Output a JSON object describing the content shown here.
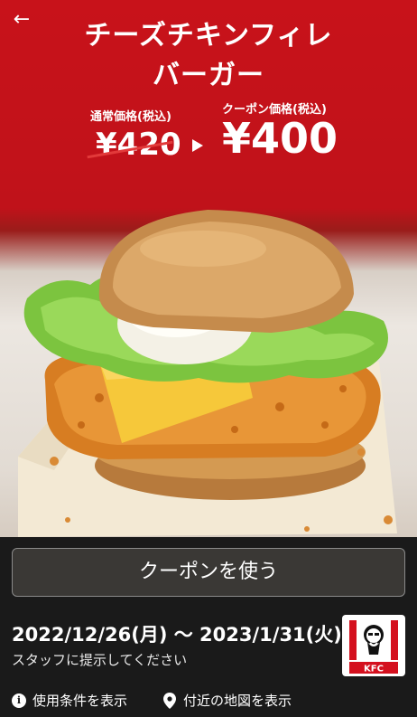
{
  "header": {
    "back_icon": "arrow-left-icon",
    "title_line1": "チーズチキンフィレ",
    "title_line2": "バーガー"
  },
  "pricing": {
    "regular_label": "通常価格(税込)",
    "regular_price": "¥420",
    "coupon_label": "クーポン価格(税込)",
    "coupon_price": "¥400"
  },
  "actions": {
    "use_coupon": "クーポンを使う"
  },
  "coupon": {
    "validity": "2022/12/26(月) 〜 2023/1/31(火)",
    "staff_note": "スタッフに提示してください",
    "logo_text": "KFC"
  },
  "footer_links": {
    "terms": "使用条件を表示",
    "map": "付近の地図を表示"
  },
  "colors": {
    "brand_red": "#c8121a",
    "background": "#1a1a1a",
    "button_bg": "#3a3835"
  }
}
